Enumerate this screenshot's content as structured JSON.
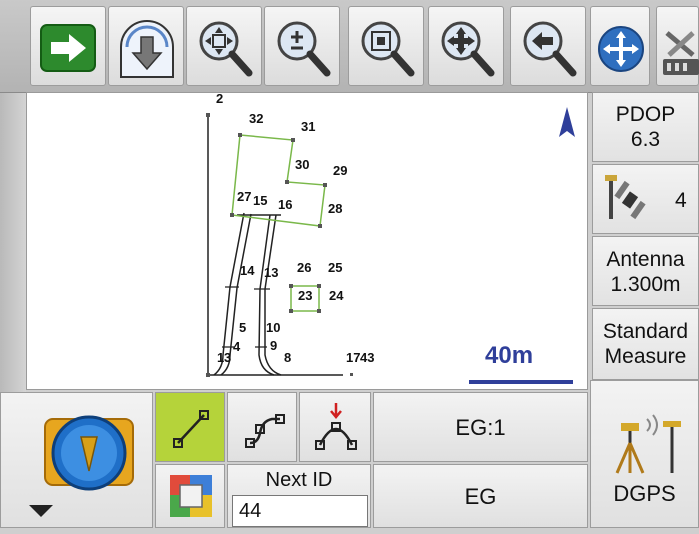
{
  "toolbar": {
    "buttons": [
      {
        "name": "next-arrow-button",
        "icon": "right-arrow-icon"
      },
      {
        "name": "download-button",
        "icon": "globe-down-arrow-icon"
      },
      {
        "name": "zoom-extent-button",
        "icon": "zoom-extent-icon"
      },
      {
        "name": "zoom-in-out-button",
        "icon": "zoom-plus-minus-icon"
      },
      {
        "name": "zoom-window-button",
        "icon": "zoom-window-icon"
      },
      {
        "name": "pan-button",
        "icon": "pan-magnifier-icon"
      },
      {
        "name": "zoom-previous-button",
        "icon": "zoom-back-icon"
      },
      {
        "name": "move-button",
        "icon": "move-arrows-icon"
      },
      {
        "name": "settings-button",
        "icon": "tools-icon"
      }
    ]
  },
  "map": {
    "scale_label": "40m",
    "colors": {
      "outline": "#7ab84a",
      "line": "#222222",
      "scale": "#2f3f9a",
      "north": "#2f3f9a"
    },
    "labels": [
      "2",
      "32",
      "31",
      "30",
      "29",
      "27",
      "15",
      "16",
      "28",
      "14",
      "13",
      "26",
      "25",
      "23",
      "24",
      "5",
      "10",
      "4",
      "9",
      "1",
      "3",
      "8",
      "17",
      "43"
    ]
  },
  "status": {
    "pdop_label": "PDOP",
    "pdop_value": "6.3",
    "satellites": "4",
    "antenna_label": "Antenna",
    "antenna_value": "1.300m",
    "mode_line1": "Standard",
    "mode_line2": "Measure",
    "receiver_label": "DGPS"
  },
  "bottom": {
    "code_label": "EG:1",
    "code_value": "EG",
    "next_id_label": "Next ID",
    "next_id_value": "44"
  }
}
